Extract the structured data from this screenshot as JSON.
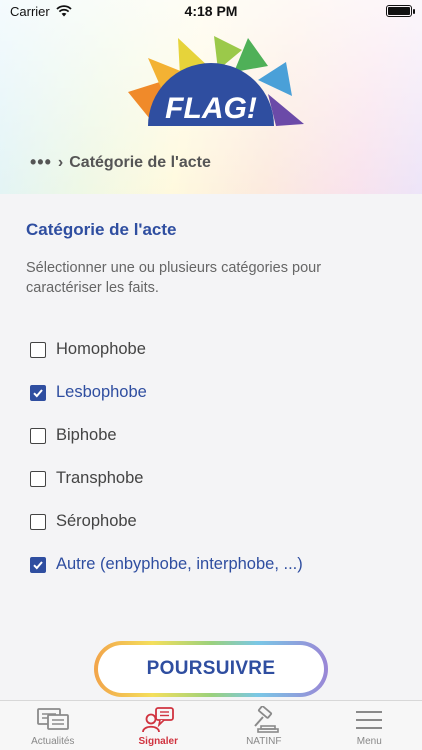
{
  "status_bar": {
    "carrier": "Carrier",
    "time": "4:18 PM"
  },
  "header": {
    "logo_text": "FLAG!",
    "breadcrumb": {
      "ellipsis": "•••",
      "current": "Catégorie de l'acte"
    }
  },
  "content": {
    "title": "Catégorie de l'acte",
    "description": "Sélectionner une ou plusieurs catégories pour caractériser les faits.",
    "options": [
      {
        "label": "Homophobe",
        "checked": false
      },
      {
        "label": "Lesbophobe",
        "checked": true
      },
      {
        "label": "Biphobe",
        "checked": false
      },
      {
        "label": "Transphobe",
        "checked": false
      },
      {
        "label": "Sérophobe",
        "checked": false
      },
      {
        "label": "Autre (enbyphobe, interphobe, ...)",
        "checked": true
      }
    ]
  },
  "actions": {
    "continue_label": "POURSUIVRE"
  },
  "tabbar": {
    "active": "signaler",
    "items": [
      {
        "id": "actualites",
        "label": "Actualités",
        "icon": "news-icon"
      },
      {
        "id": "signaler",
        "label": "Signaler",
        "icon": "report-icon"
      },
      {
        "id": "natinf",
        "label": "NATINF",
        "icon": "gavel-icon"
      },
      {
        "id": "menu",
        "label": "Menu",
        "icon": "hamburger-menu-icon"
      }
    ]
  },
  "colors": {
    "primary": "#2f4ea0",
    "active_tab": "#d0333f"
  }
}
